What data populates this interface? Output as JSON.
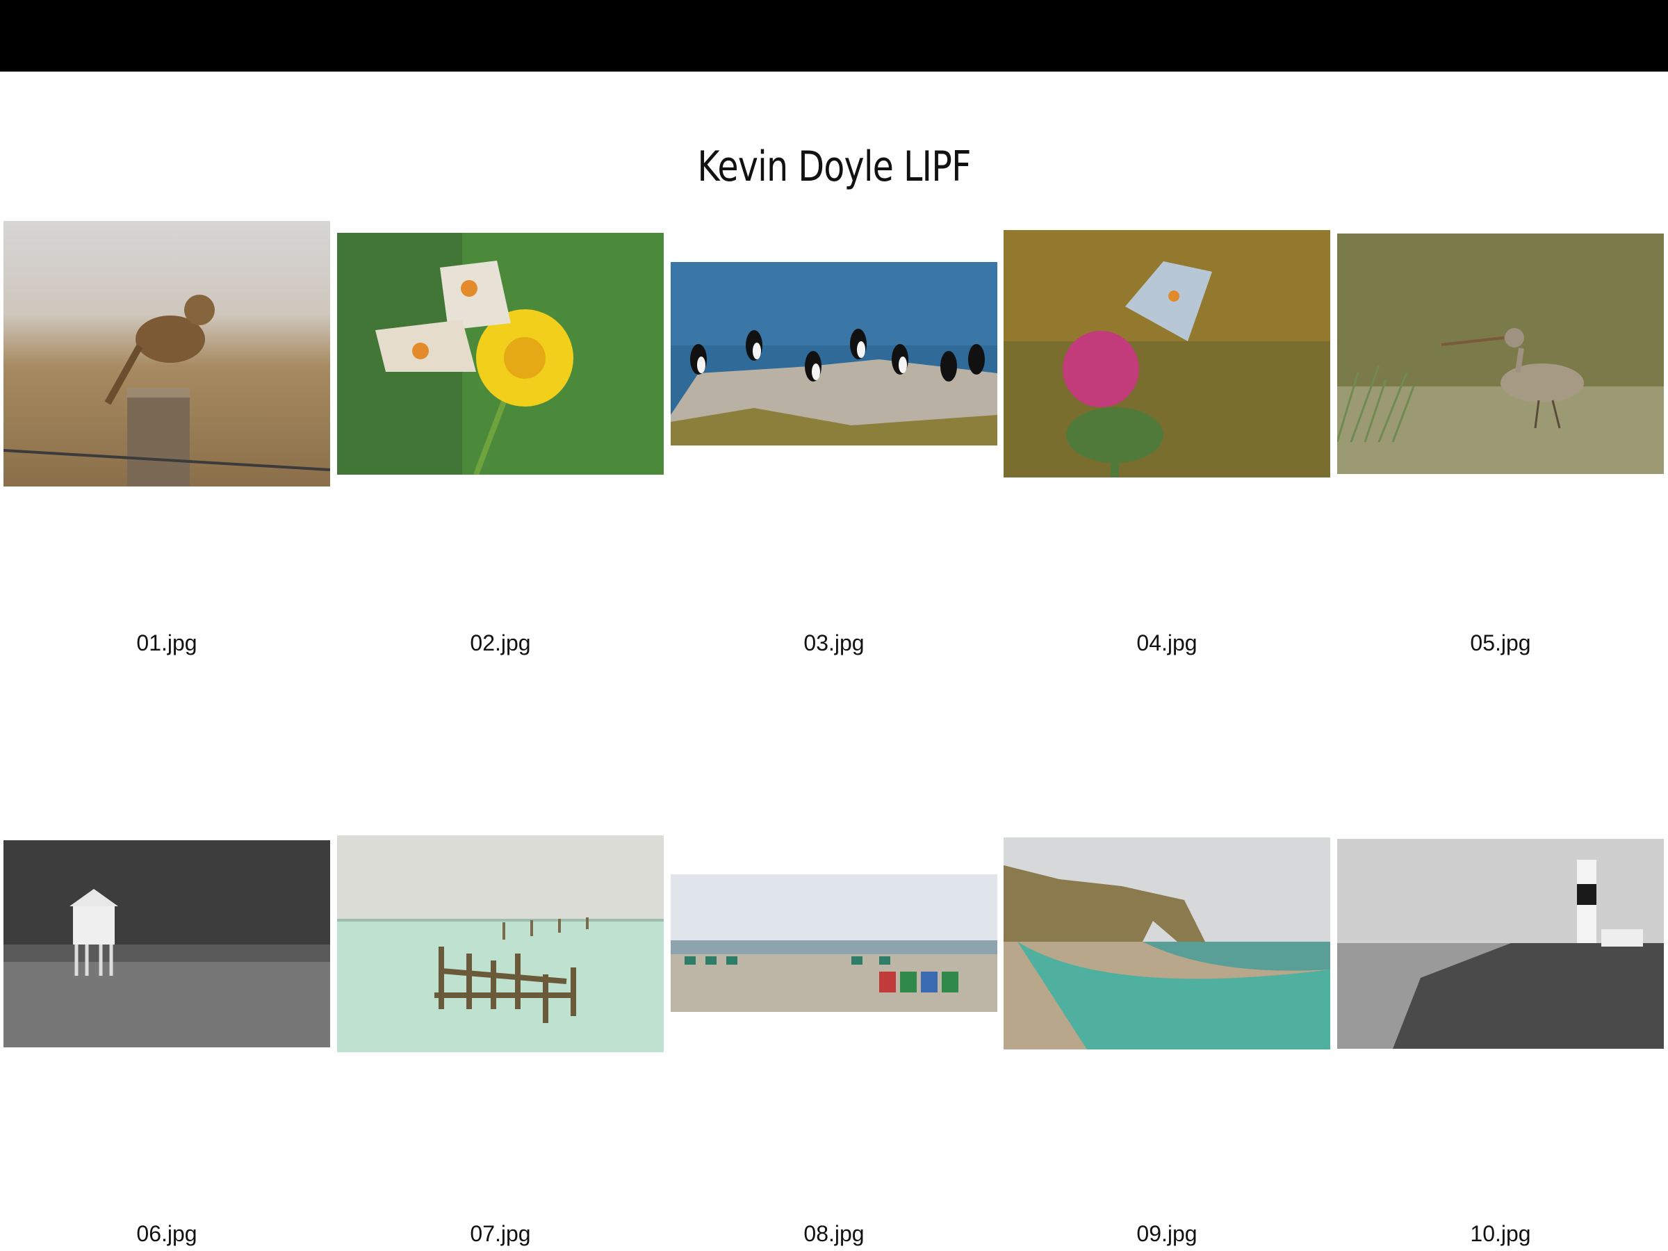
{
  "title": "Kevin Doyle LIPF",
  "images": [
    {
      "filename": "01.jpg",
      "subject": "skylark on fence post"
    },
    {
      "filename": "02.jpg",
      "subject": "spotted fritillary butterflies on yellow flower"
    },
    {
      "filename": "03.jpg",
      "subject": "puffins on rock by sea"
    },
    {
      "filename": "04.jpg",
      "subject": "blue butterfly on thistle"
    },
    {
      "filename": "05.jpg",
      "subject": "godwit wading in water"
    },
    {
      "filename": "06.jpg",
      "subject": "low lighthouse on beach, monochrome"
    },
    {
      "filename": "07.jpg",
      "subject": "old pier ruins in calm sea"
    },
    {
      "filename": "08.jpg",
      "subject": "deckchairs on pebble beach"
    },
    {
      "filename": "09.jpg",
      "subject": "Durdle Door arch"
    },
    {
      "filename": "10.jpg",
      "subject": "lighthouse on rocky coast, monochrome"
    }
  ]
}
